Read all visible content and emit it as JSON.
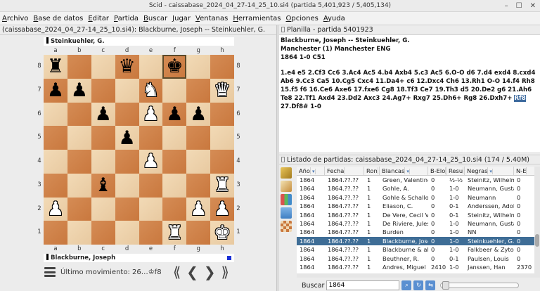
{
  "window": {
    "title": "Scid - caissabase_2024_04_27-14_25_10.si4 (partida 5,401,923 / 5,405,134)",
    "controls": [
      "–",
      "☐",
      "✕"
    ]
  },
  "menu": [
    {
      "label": "Archivo",
      "key": "A",
      "rest": "rchivo"
    },
    {
      "label": "Base de datos",
      "key": "B",
      "rest": "ase de datos"
    },
    {
      "label": "Editar",
      "key": "E",
      "rest": "ditar"
    },
    {
      "label": "Partida",
      "key": "P",
      "rest": "artida"
    },
    {
      "label": "Buscar",
      "key": "B",
      "rest": "uscar"
    },
    {
      "label": "Jugar",
      "key": "J",
      "rest": "ugar"
    },
    {
      "label": "Ventanas",
      "key": "V",
      "rest": "entanas"
    },
    {
      "label": "Herramientas",
      "key": "H",
      "rest": "erramientas"
    },
    {
      "label": "Opciones",
      "key": "O",
      "rest": "pciones"
    },
    {
      "label": "Ayuda",
      "key": "A",
      "rest": "yuda"
    }
  ],
  "board_panel": {
    "header": "(caissabase_2024_04_27-14_25_10.si4): Blackburne, Joseph -- Steinkuehler, G.",
    "top_player": "Steinkuehler, G.",
    "bottom_player": "Blackburne, Joseph",
    "files": [
      "a",
      "b",
      "c",
      "d",
      "e",
      "f",
      "g",
      "h"
    ],
    "ranks": [
      "8",
      "7",
      "6",
      "5",
      "4",
      "3",
      "2",
      "1"
    ],
    "position": [
      [
        "r",
        "",
        "",
        "q",
        "",
        "k",
        "",
        ""
      ],
      [
        "p",
        "p",
        "",
        "",
        "N",
        "",
        "",
        "Q"
      ],
      [
        "",
        "",
        "p",
        "",
        "P",
        "p",
        "p",
        ""
      ],
      [
        "",
        "",
        "",
        "p",
        "",
        "",
        "",
        ""
      ],
      [
        "",
        "",
        "",
        "",
        "P",
        "",
        "",
        ""
      ],
      [
        "",
        "",
        "b",
        "",
        "",
        "",
        "",
        "R"
      ],
      [
        "P",
        "",
        "",
        "",
        "",
        "",
        "P",
        "P"
      ],
      [
        "",
        "",
        "",
        "",
        "",
        "R",
        "",
        "K"
      ]
    ],
    "last_move": "Último movimiento: 26…♔f8",
    "nav_buttons": [
      "⟪",
      "❮",
      "❯",
      "⟫"
    ]
  },
  "notation_panel": {
    "tab": "Planilla - partida 5401923",
    "header_line1": "Blackburne, Joseph   --   Steinkuehler, G.",
    "header_line2": "Manchester (1)  Manchester ENG",
    "header_line3": "1864  1-0  C51",
    "moves_before": "1.e4 e5 2.Cf3 Cc6 3.Ac4 Ac5 4.b4 Axb4 5.c3 Ac5 6.O-O d6 7.d4 exd4 8.cxd4 Ab6 9.Cc3 Ca5 10.Cg5 Cxc4 11.Da4+ c6 12.Dxc4 Ch6 13.Rh1 O-O 14.f4 Rh8 15.f5 f6 16.Ce6 Axe6 17.fxe6 Cg8 18.Tf3 Ce7 19.Th3 d5 20.De2 g6 21.Ah6 Te8 22.Tf1 Axd4 23.Dd2 Axc3 24.Ag7+ Rxg7 25.Dh6+ Rg8 26.Dxh7+ ",
    "current_move": "Rf8",
    "moves_after": " 27.Df8# 1-0"
  },
  "list_panel": {
    "tab": "Listado de partidas: caissabase_2024_04_27-14_25_10.si4 (174 / 5.40M)",
    "columns": [
      "Año",
      "Fecha",
      "Ron",
      "Blancas",
      "B-Elo",
      "Resu",
      "Negras",
      "N-E"
    ],
    "rows": [
      [
        "1864",
        "1864.??.??",
        "1",
        "Green, Valentine",
        "0",
        "½-½",
        "Steinitz, Wilhelm",
        "0"
      ],
      [
        "1864",
        "1864.??.??",
        "1",
        "Gohle, A.",
        "0",
        "1-0",
        "Neumann, Gustav",
        "0"
      ],
      [
        "1864",
        "1864.??.??",
        "1",
        "Gohle & Schallopp",
        "0",
        "1-0",
        "Neumann",
        "0"
      ],
      [
        "1864",
        "1864.??.??",
        "1",
        "Eliason, C.",
        "0",
        "0-1",
        "Anderssen, Adolf",
        "0"
      ],
      [
        "1864",
        "1864.??.??",
        "1",
        "De Vere, Cecil V",
        "0",
        "0-1",
        "Steinitz, Wilhelm",
        "0"
      ],
      [
        "1864",
        "1864.??.??",
        "1",
        "De Riviere, Jules",
        "0",
        "1-0",
        "Neumann, Gustav",
        "0"
      ],
      [
        "1864",
        "1864.??.??",
        "1",
        "Burden",
        "0",
        "1-0",
        "NN",
        "0"
      ],
      [
        "1864",
        "1864.??.??",
        "1",
        "Blackburne, Joseph",
        "0",
        "1-0",
        "Steinkuehler, G.",
        "0"
      ],
      [
        "1864",
        "1864.??.??",
        "1",
        "Blackburne & allies",
        "0",
        "1-0",
        "Falkbeer & Zytogorski",
        "0"
      ],
      [
        "1864",
        "1864.??.??",
        "1",
        "Beuthner, R.",
        "0",
        "0-1",
        "Paulsen, Louis",
        "0"
      ],
      [
        "1864",
        "1864.??.??",
        "1",
        "Andres, Miguel",
        "2410",
        "1-0",
        "Janssen, Han",
        "2370"
      ]
    ],
    "selected_row": 7,
    "search_label": "Buscar",
    "search_value": "1864"
  },
  "colors": {
    "light_square": "#efd6b0",
    "dark_square": "#d3864d",
    "selection": "#3e6d96"
  }
}
